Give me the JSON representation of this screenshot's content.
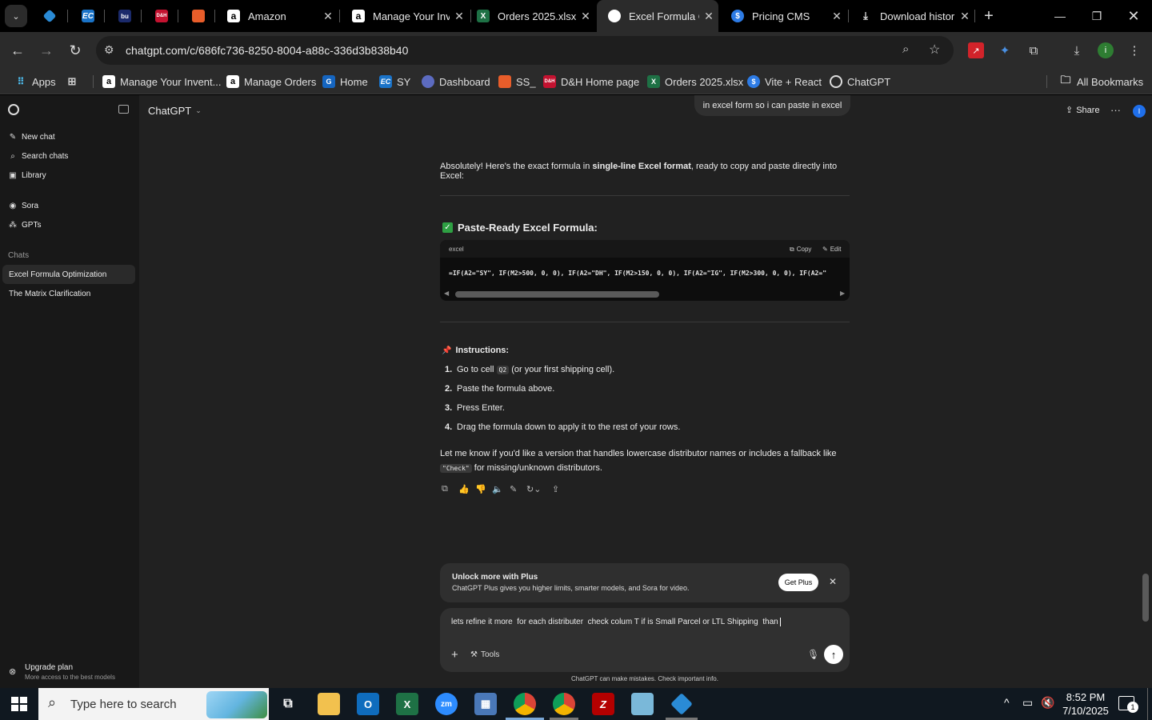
{
  "browser": {
    "tabs": [
      {
        "title": "",
        "icon": "diamond-icon",
        "color": "#2a8bd6"
      },
      {
        "title": "",
        "icon": "ec-icon",
        "color": "#1a73c8",
        "text": "EC"
      },
      {
        "title": "",
        "icon": "bu-icon",
        "color": "#1b2a6b",
        "text": "bu"
      },
      {
        "title": "",
        "icon": "dh-icon",
        "color": "#c41230",
        "text": "D&H"
      },
      {
        "title": "",
        "icon": "stack-icon",
        "color": "#e85d2a"
      },
      {
        "title": "Amazon",
        "icon": "amazon-icon",
        "color": "#ffffff",
        "text": "a"
      },
      {
        "title": "Manage Your Inv",
        "icon": "amazon-icon",
        "color": "#ffffff",
        "text": "a"
      },
      {
        "title": "Orders 2025.xlsx",
        "icon": "excel-icon",
        "color": "#1e7145",
        "text": "X"
      },
      {
        "title": "Excel Formula O",
        "icon": "chatgpt-icon",
        "color": "#ffffff"
      },
      {
        "title": "Pricing CMS",
        "icon": "dollar-icon",
        "color": "#2d7be5",
        "text": "$"
      },
      {
        "title": "Download histor",
        "icon": "download-icon",
        "color": "#dddddd"
      }
    ],
    "url": "chatgpt.com/c/686fc736-8250-8004-a88c-336d3b838b40",
    "bookmarks": [
      {
        "label": "Apps",
        "icon": "apps-grid-icon"
      },
      {
        "label": "",
        "icon": "grid-icon"
      },
      {
        "label": "Manage Your Invent...",
        "icon": "amazon-icon"
      },
      {
        "label": "Manage Orders",
        "icon": "amazon-icon"
      },
      {
        "label": "Home",
        "icon": "home-icon"
      },
      {
        "label": "SY",
        "icon": "ec-icon"
      },
      {
        "label": "Dashboard",
        "icon": "dashboard-icon"
      },
      {
        "label": "SS_",
        "icon": "stack-icon"
      },
      {
        "label": "D&H Home page",
        "icon": "dh-icon"
      },
      {
        "label": "Orders 2025.xlsx",
        "icon": "excel-icon"
      },
      {
        "label": "Vite + React",
        "icon": "vite-icon"
      },
      {
        "label": "ChatGPT",
        "icon": "chatgpt-icon"
      }
    ],
    "all_bookmarks": "All Bookmarks"
  },
  "sidebar": {
    "nav": [
      {
        "label": "New chat",
        "icon": "new-chat-icon"
      },
      {
        "label": "Search chats",
        "icon": "search-icon"
      },
      {
        "label": "Library",
        "icon": "library-icon"
      },
      {
        "label": "Sora",
        "icon": "sora-icon"
      },
      {
        "label": "GPTs",
        "icon": "gpts-icon"
      }
    ],
    "chats_heading": "Chats",
    "chats": [
      "Excel Formula Optimization",
      "The Matrix Clarification"
    ],
    "upgrade_title": "Upgrade plan",
    "upgrade_sub": "More access to the best models"
  },
  "header": {
    "model": "ChatGPT",
    "share": "Share",
    "avatar_letter": "I"
  },
  "conversation": {
    "user_msg": "in excel form so i can paste in excel",
    "intro_pre": "Absolutely! Here's the exact formula in ",
    "intro_bold": "single-line Excel format",
    "intro_post": ", ready to copy and paste directly into Excel:",
    "section_title": "Paste-Ready Excel Formula:",
    "code_lang": "excel",
    "copy_label": "Copy",
    "edit_label": "Edit",
    "code": "=IF(A2=\"SY\", IF(M2>500, 0, 0), IF(A2=\"DH\", IF(M2>150, 0, 0), IF(A2=\"IG\", IF(M2>300, 0, 0), IF(A2=\"",
    "instructions_title": "Instructions:",
    "steps": [
      {
        "pre": "Go to cell ",
        "code": "Q2",
        "post": " (or your first shipping cell)."
      },
      {
        "pre": "Paste the formula above.",
        "code": "",
        "post": ""
      },
      {
        "pre": "Press Enter.",
        "code": "",
        "post": ""
      },
      {
        "pre": "Drag the formula down to apply it to the rest of your rows.",
        "code": "",
        "post": ""
      }
    ],
    "followup_pre": "Let me know if you'd like a version that handles lowercase distributor names or includes a fallback like",
    "followup_code": "\"Check\"",
    "followup_post": " for missing/unknown distributors."
  },
  "plus_card": {
    "title": "Unlock more with Plus",
    "sub": "ChatGPT Plus gives you higher limits, smarter models, and Sora for video.",
    "button": "Get Plus"
  },
  "composer": {
    "text": "lets refine it more  for each distributer  check colum T if is Small Parcel or LTL Shipping  than ",
    "tools": "Tools"
  },
  "disclaimer": "ChatGPT can make mistakes. Check important info.",
  "taskbar": {
    "search_placeholder": "Type here to search",
    "time": "8:52 PM",
    "date": "7/10/2025",
    "notif_count": "1"
  }
}
